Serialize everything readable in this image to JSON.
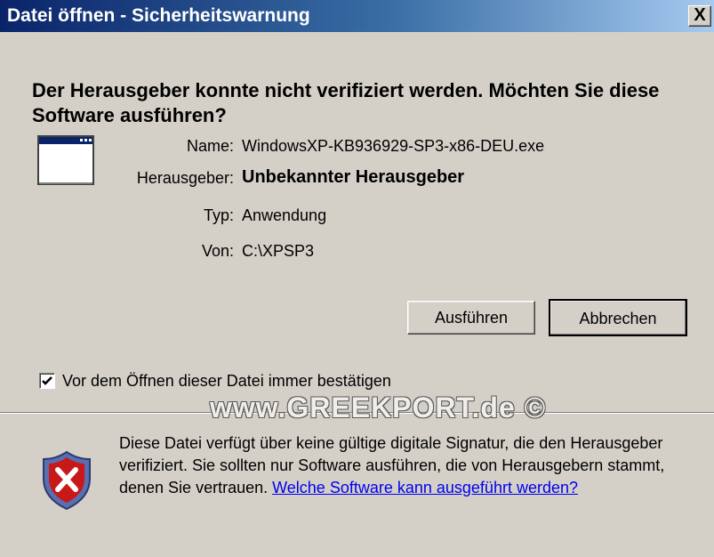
{
  "window": {
    "title": "Datei öffnen - Sicherheitswarnung",
    "close_label": "X"
  },
  "question": "Der Herausgeber konnte nicht verifiziert werden. Möchten Sie diese Software ausführen?",
  "file_info": {
    "name_label": "Name:",
    "name_value": "WindowsXP-KB936929-SP3-x86-DEU.exe",
    "publisher_label": "Herausgeber:",
    "publisher_value": "Unbekannter Herausgeber",
    "type_label": "Typ:",
    "type_value": "Anwendung",
    "from_label": "Von:",
    "from_value": "C:\\XPSP3"
  },
  "buttons": {
    "run_label": "Ausführen",
    "cancel_label": "Abbrechen"
  },
  "checkbox": {
    "label": "Vor dem Öffnen dieser Datei immer bestätigen",
    "checked": true
  },
  "watermark": "www.GREEKPORT.de ©",
  "warning": {
    "text": "Diese Datei verfügt über keine gültige digitale Signatur, die den Herausgeber verifiziert. Sie sollten nur Software ausführen, die von Herausgebern stammt, denen Sie vertrauen. ",
    "link": "Welche Software kann ausgeführt werden?"
  },
  "icons": {
    "app": "application-window-icon",
    "shield": "security-shield-error-icon",
    "check": "checkmark-icon"
  },
  "colors": {
    "titlebar_start": "#0a246a",
    "titlebar_end": "#a6caf0",
    "dialog_bg": "#d4d0c8",
    "link": "#0000ee",
    "shield_red": "#c81818"
  }
}
